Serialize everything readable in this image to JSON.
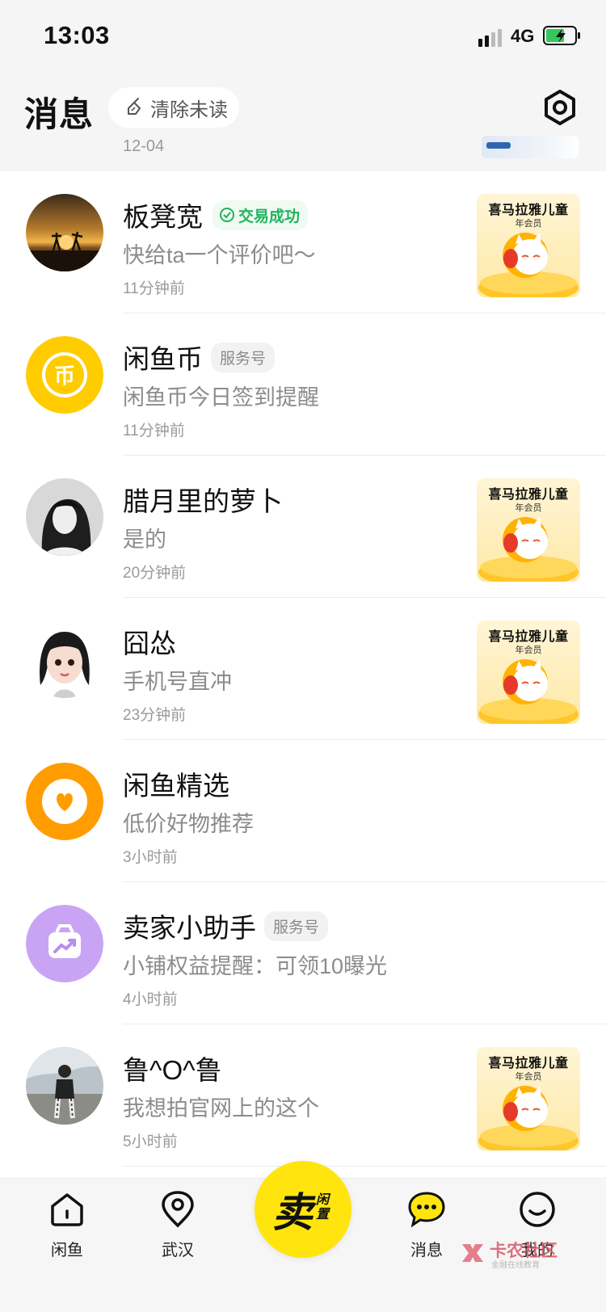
{
  "status_bar": {
    "time": "13:03",
    "network": "4G"
  },
  "header": {
    "title": "消息",
    "clear_unread": "清除未读",
    "peek_date": "12-04"
  },
  "conversations": [
    {
      "name": "板凳宽",
      "badge": "交易成功",
      "preview": "快给ta一个评价吧～",
      "time": "11分钟前",
      "thumb_title": "喜马拉雅儿童",
      "thumb_sub": "年会员"
    },
    {
      "name": "闲鱼币",
      "badge": "服务号",
      "preview": "闲鱼币今日签到提醒",
      "time": "11分钟前",
      "avatar_glyph": "币"
    },
    {
      "name": "腊月里的萝卜",
      "preview": "是的",
      "time": "20分钟前",
      "thumb_title": "喜马拉雅儿童",
      "thumb_sub": "年会员"
    },
    {
      "name": "囧怂",
      "preview": "手机号直冲",
      "time": "23分钟前",
      "thumb_title": "喜马拉雅儿童",
      "thumb_sub": "年会员"
    },
    {
      "name": "闲鱼精选",
      "preview": "低价好物推荐",
      "time": "3小时前"
    },
    {
      "name": "卖家小助手",
      "badge": "服务号",
      "preview": "小铺权益提醒：可领10曝光",
      "time": "4小时前"
    },
    {
      "name": "鲁^O^鲁",
      "preview": "我想拍官网上的这个",
      "time": "5小时前",
      "thumb_title": "喜马拉雅儿童",
      "thumb_sub": "年会员"
    }
  ],
  "tabbar": {
    "home": "闲鱼",
    "city": "武汉",
    "sell_main": "卖",
    "sell_sub": "闲置",
    "messages": "消息",
    "mine": "我的"
  },
  "watermark": {
    "text": "卡农社区",
    "sub": "金融在线教育"
  },
  "colors": {
    "accent_yellow": "#ffe50d",
    "success_green": "#22b35e",
    "coin_yellow": "#ffcc00",
    "select_orange": "#ff9d00",
    "helper_purple": "#b98cf0"
  }
}
